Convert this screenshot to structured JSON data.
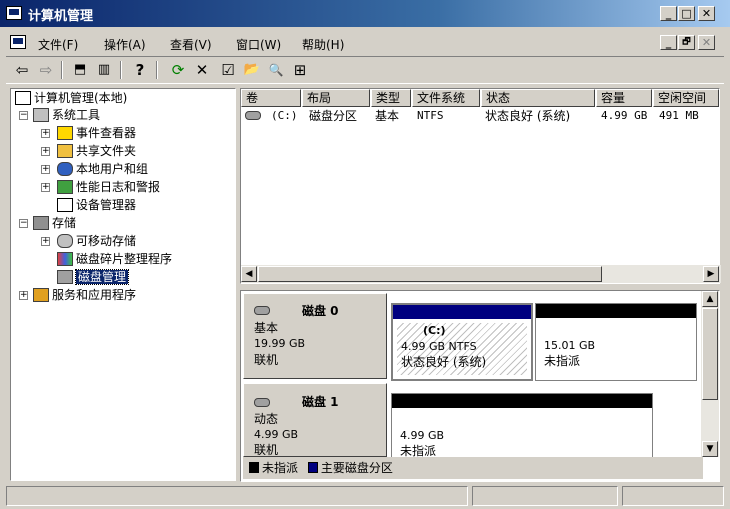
{
  "window": {
    "title": "计算机管理",
    "minimize": "_",
    "maximize": "□",
    "close": "✕"
  },
  "menu": {
    "items": [
      "文件(F)",
      "操作(A)",
      "查看(V)",
      "窗口(W)",
      "帮助(H)"
    ],
    "mdi_minimize": "_",
    "mdi_restore": "🗗",
    "mdi_close": "✕"
  },
  "toolbar": {
    "back": "⇦",
    "forward": "⇨",
    "up": "⬒",
    "show_hide": "▥",
    "help": "?",
    "refresh": "⟳",
    "delete": "✕",
    "properties": "☑",
    "open": "📂",
    "search": "🔍",
    "export": "⊞"
  },
  "tree": {
    "root": "计算机管理(本地)",
    "system_tools": "系统工具",
    "event_viewer": "事件查看器",
    "shared_folders": "共享文件夹",
    "local_users": "本地用户和组",
    "perf_logs": "性能日志和警报",
    "device_manager": "设备管理器",
    "storage": "存储",
    "removable": "可移动存储",
    "defrag": "磁盘碎片整理程序",
    "disk_mgmt": "磁盘管理",
    "services": "服务和应用程序"
  },
  "volume_list": {
    "columns": [
      "卷",
      "布局",
      "类型",
      "文件系统",
      "状态",
      "容量",
      "空闲空间"
    ],
    "rows": [
      {
        "volume": "(C:)",
        "layout": "磁盘分区",
        "type": "基本",
        "fs": "NTFS",
        "status": "状态良好 (系统)",
        "capacity": "4.99 GB",
        "free": "491 MB"
      }
    ]
  },
  "disks": [
    {
      "name": "磁盘 0",
      "type": "基本",
      "size": "19.99 GB",
      "state": "联机",
      "partitions": [
        {
          "label": "(C:)",
          "detail": "4.99 GB NTFS",
          "status": "状态良好 (系统)",
          "kind": "primary"
        },
        {
          "label": "",
          "detail": "15.01 GB",
          "status": "未指派",
          "kind": "unallocated"
        }
      ]
    },
    {
      "name": "磁盘 1",
      "type": "动态",
      "size": "4.99 GB",
      "state": "联机",
      "partitions": [
        {
          "label": "",
          "detail": "4.99 GB",
          "status": "未指派",
          "kind": "unallocated"
        }
      ]
    }
  ],
  "legend": {
    "unallocated": "未指派",
    "primary": "主要磁盘分区"
  },
  "colors": {
    "title_start": "#0a246a",
    "selection": "#0a246a",
    "primary_partition": "#000080",
    "unallocated": "#000000",
    "face": "#d4d0c8"
  }
}
